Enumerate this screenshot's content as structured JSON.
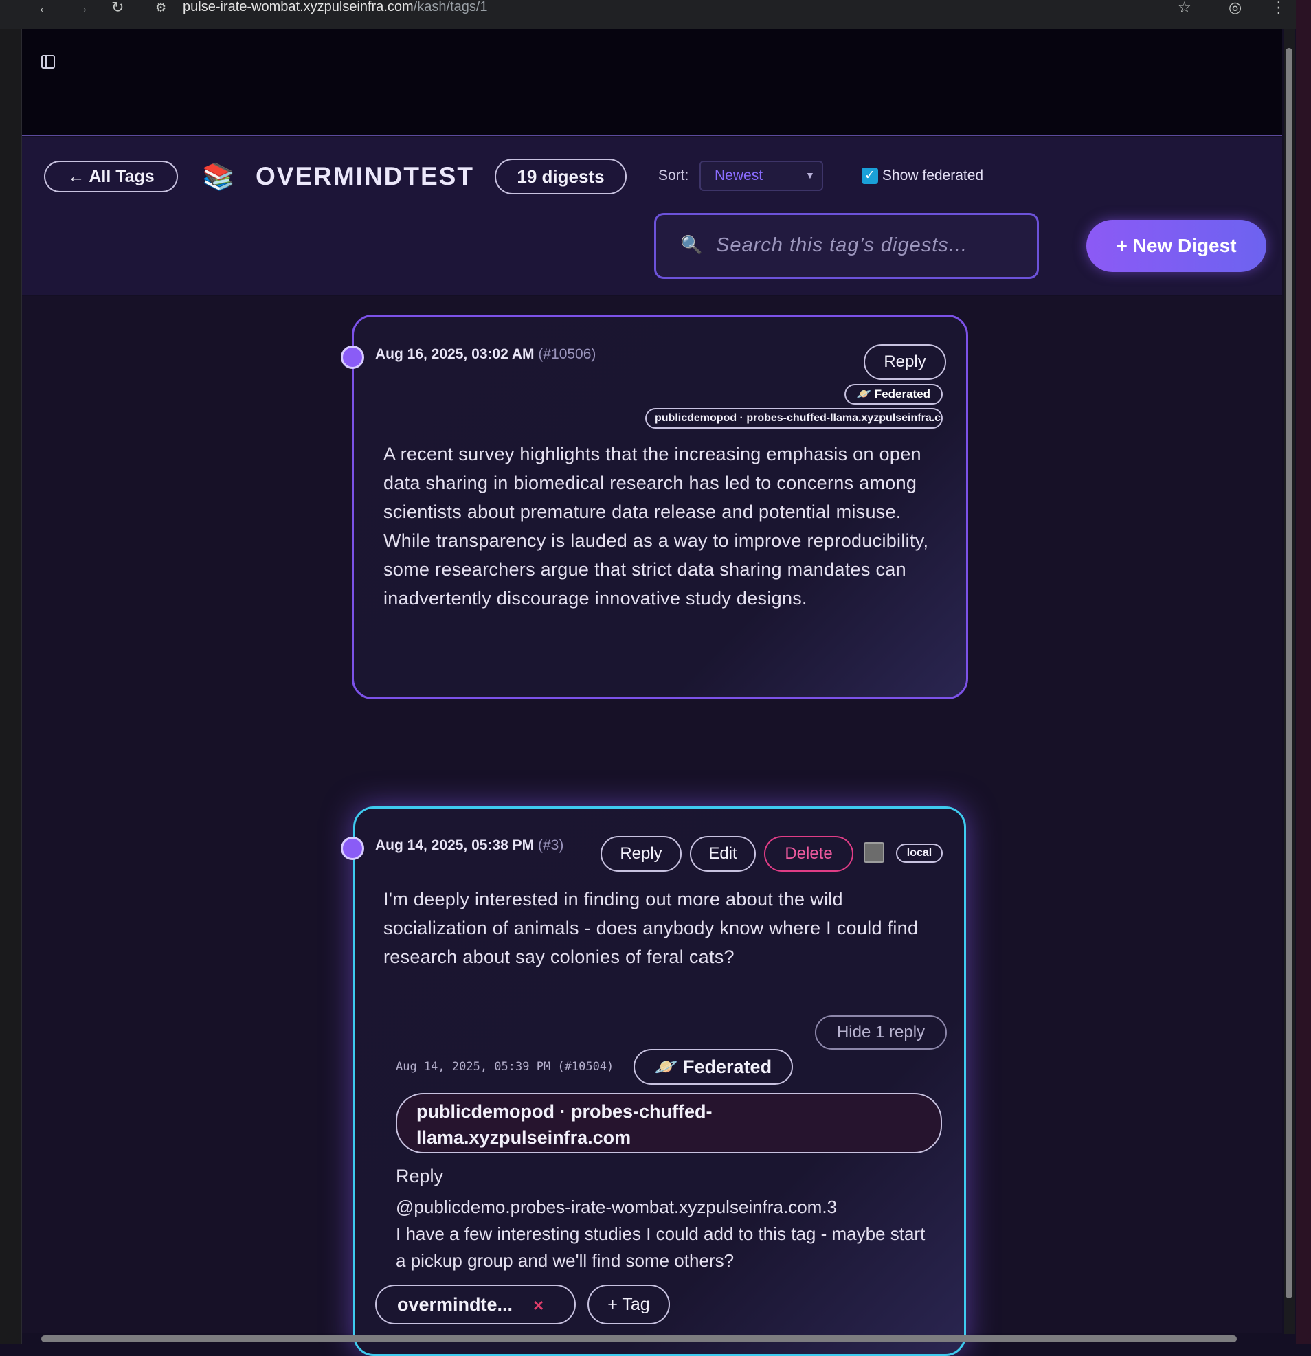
{
  "browser": {
    "url_host": "pulse-irate-wombat.xyzpulseinfra.com",
    "url_path": "/kash/tags/1",
    "icons": [
      "back-arrow-icon",
      "forward-arrow-icon",
      "reload-icon",
      "site-info-icon",
      "star-icon",
      "profile-icon",
      "kebab-menu-icon"
    ]
  },
  "header": {
    "back_label": "← All Tags",
    "tag_emoji": "📚",
    "tag_title": "OVERMINDTEST",
    "digest_count": "19 digests",
    "sort_label": "Sort:",
    "sort_value": "Newest",
    "show_federated_label": "Show federated",
    "show_federated_checked": true,
    "search_icon": "🔍",
    "search_placeholder": "Search this tag’s digests...",
    "new_digest_label": "+ New Digest"
  },
  "digests": [
    {
      "date": "Aug 16, 2025, 03:02 AM",
      "id": "(#10506)",
      "reply_label": "Reply",
      "federated_label": "🪐 Federated",
      "origin": "publicdemopod · probes-chuffed-llama.xyzpulseinfra.com",
      "body": "A recent survey highlights that the increasing emphasis on open data sharing in biomedical research has led to concerns among scientists about premature data release and potential misuse. While transparency is lauded as a way to improve reproducibility, some researchers argue that strict data sharing mandates can inadvertently discourage innovative study designs."
    },
    {
      "date": "Aug 14, 2025, 05:38 PM",
      "id": "(#3)",
      "reply_label": "Reply",
      "edit_label": "Edit",
      "delete_label": "Delete",
      "local_label": "local",
      "body": "I'm deeply interested in finding out more about the wild socialization of animals - does anybody know where I could find research about say colonies of feral cats?",
      "hide_replies_label": "Hide 1 reply",
      "reply": {
        "date": "Aug 14, 2025, 05:39 PM (#10504)",
        "federated_label": "🪐 Federated",
        "origin": "publicdemopod · probes-chuffed-llama.xyzpulseinfra.com",
        "label": "Reply",
        "mention": "@publicdemo.probes-irate-wombat.xyzpulseinfra.com.3",
        "body": "I have a few interesting studies I could add to this tag - maybe start a pickup group and we'll find some others?"
      },
      "tag_chip": "overmindte...",
      "tag_chip_remove": "×",
      "add_tag_label": "+ Tag"
    }
  ],
  "colors": {
    "accent": "#8c5af5",
    "card1_border": "#7c52e8",
    "card2_border": "#3ecbef",
    "delete": "#e03d86",
    "background": "#171127"
  }
}
